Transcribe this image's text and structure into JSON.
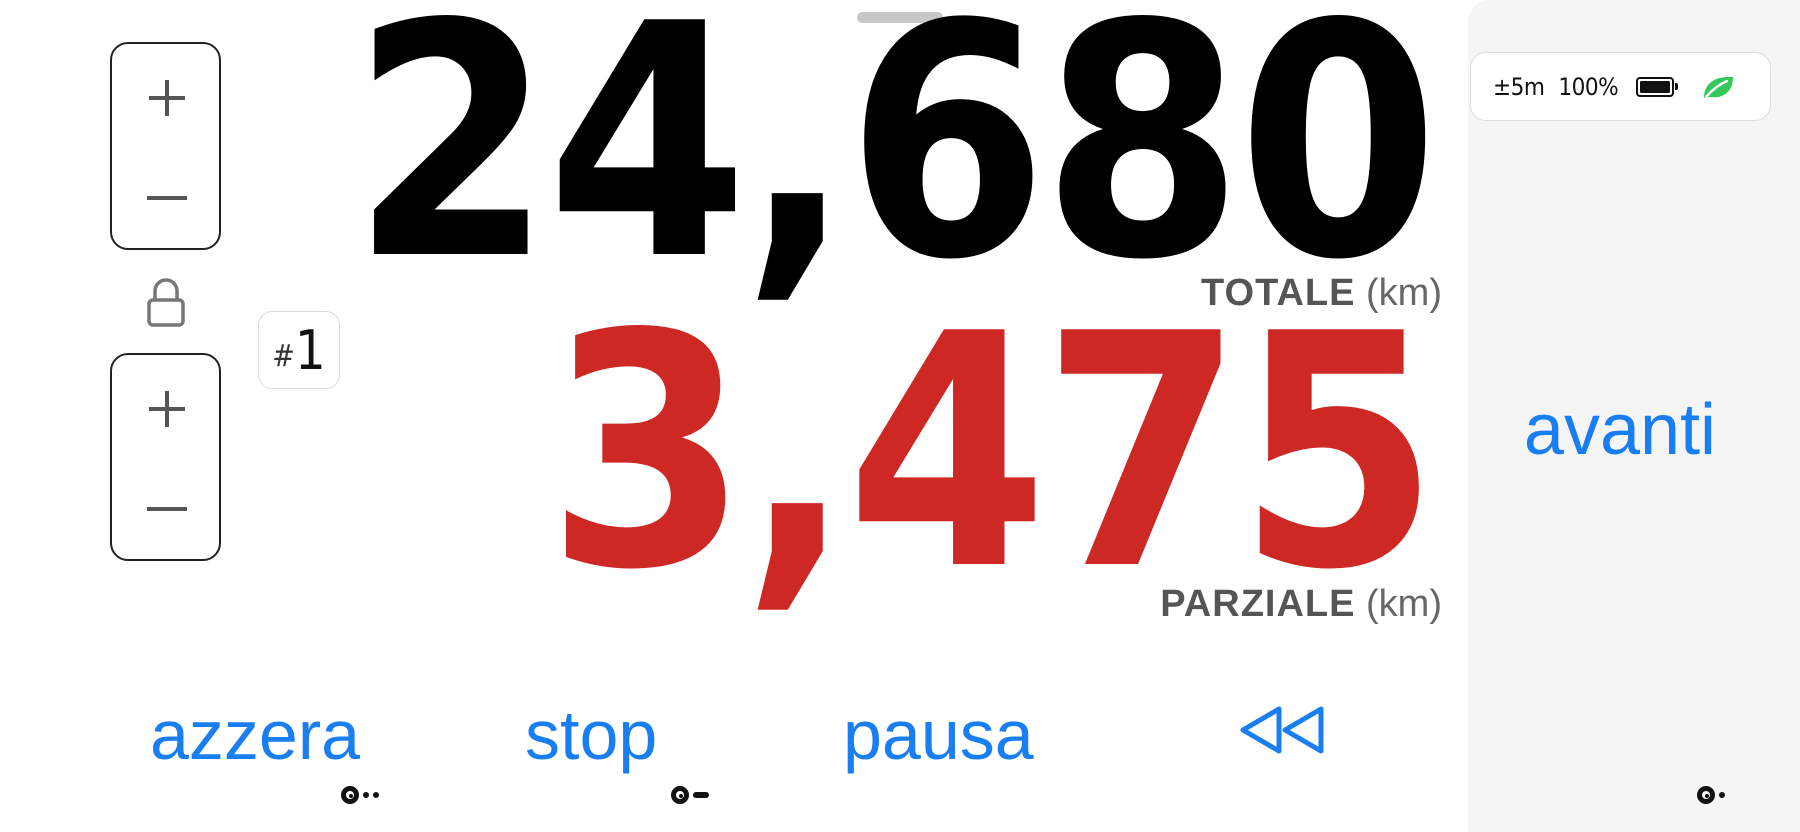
{
  "odometer": {
    "total_value": "24,680",
    "total_label": "TOTALE",
    "total_unit": "(km)",
    "partial_value": "3,475",
    "partial_label": "PARZIALE",
    "partial_unit": "(km)",
    "trip_hash": "#",
    "trip_number": "1"
  },
  "status": {
    "accuracy": "±5m",
    "battery_percent": "100%",
    "battery_level": 1.0,
    "eco_icon": "leaf-icon"
  },
  "actions": {
    "avanti": "avanti",
    "azzera": "azzera",
    "stop": "stop",
    "pausa": "pausa",
    "rewind_icon": "rewind-icon"
  },
  "icons": {
    "plus": "plus-icon",
    "minus": "minus-icon",
    "lock": "lock-icon"
  },
  "colors": {
    "accent": "#1a7ef3",
    "partial": "#cd2824",
    "total": "#000000",
    "eco": "#34c759"
  }
}
